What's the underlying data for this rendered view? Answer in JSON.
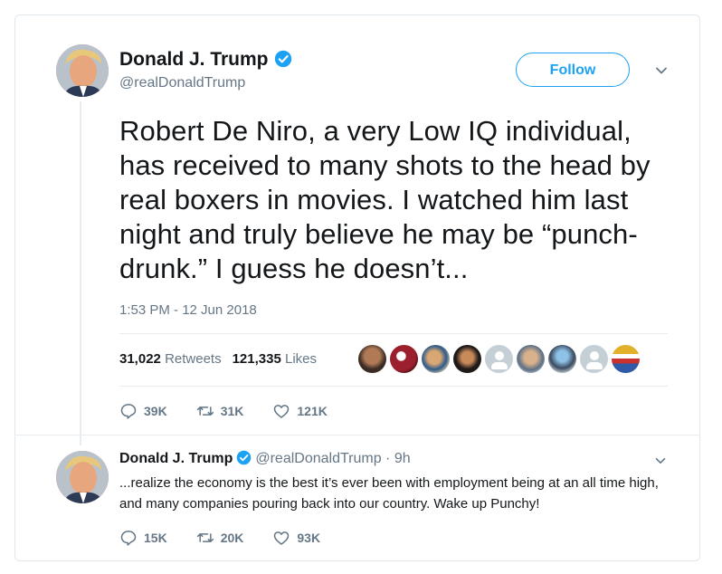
{
  "tweet": {
    "author_name": "Donald J. Trump",
    "handle": "@realDonaldTrump",
    "follow_label": "Follow",
    "text": "Robert De Niro, a very Low IQ individual, has received to many shots to the head by real boxers in movies. I watched him last night and truly believe he may be “punch-drunk.” I guess he doesn’t...",
    "timestamp": "1:53 PM - 12 Jun 2018",
    "retweets_count": "31,022",
    "retweets_label": "Retweets",
    "likes_count": "121,335",
    "likes_label": "Likes",
    "actions": {
      "replies": "39K",
      "retweets": "31K",
      "likes": "121K"
    },
    "liker_avatars": [
      "photo",
      "photo",
      "photo",
      "photo",
      "default",
      "photo",
      "photo",
      "default",
      "photo"
    ]
  },
  "reply": {
    "author_name": "Donald J. Trump",
    "handle_time": "@realDonaldTrump · 9h",
    "text": "...realize the economy is the best it’s ever been with employment being at an all time high, and many companies pouring back into our country. Wake up Punchy!",
    "actions": {
      "replies": "15K",
      "retweets": "20K",
      "likes": "93K"
    }
  },
  "colors": {
    "accent": "#1da1f2",
    "text": "#14171a",
    "secondary": "#657786",
    "border": "#e6ecf0"
  },
  "icons": [
    "verified-badge-icon",
    "chevron-down-icon",
    "reply-icon",
    "retweet-icon",
    "like-icon",
    "default-avatar-icon"
  ]
}
